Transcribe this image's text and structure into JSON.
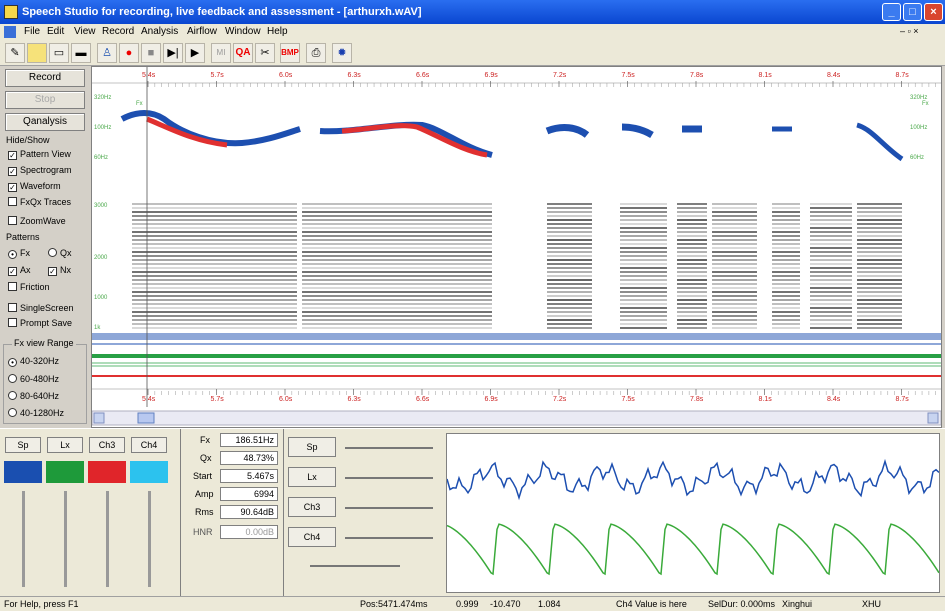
{
  "window": {
    "title": "Speech Studio for recording, live feedback and assessment - [arthurxh.wAV]"
  },
  "menu": [
    "File",
    "Edit",
    "View",
    "Record",
    "Analysis",
    "Airflow",
    "Window",
    "Help"
  ],
  "toolbar": {
    "qa": "QA",
    "bmp": "BMP"
  },
  "left": {
    "record": "Record",
    "stop": "Stop",
    "qanalysis": "Qanalysis",
    "hideshow": "Hide/Show",
    "pattern_view": "Pattern View",
    "spectrogram": "Spectrogram",
    "waveform": "Waveform",
    "fxqx": "FxQx Traces",
    "zoomwave": "ZoomWave",
    "patterns": "Patterns",
    "fx": "Fx",
    "qx": "Qx",
    "ax": "Ax",
    "nx": "Nx",
    "friction": "Friction",
    "singlescreen": "SingleScreen",
    "promptsave": "Prompt Save",
    "fxrange": "Fx view Range",
    "ranges": [
      "40-320Hz",
      "60-480Hz",
      "80-640Hz",
      "40-1280Hz"
    ]
  },
  "timeline": {
    "ticks": [
      "5.4s",
      "5.7s",
      "6.0s",
      "6.3s",
      "6.6s",
      "6.9s",
      "7.2s",
      "7.5s",
      "7.8s",
      "8.1s",
      "8.4s",
      "8.7s"
    ]
  },
  "axis": {
    "fx_hi": "320Hz",
    "fx_mid": "100Hz",
    "fx_lo": "60Hz",
    "fx_label": "Fx",
    "spec": [
      "3000",
      "2000",
      "1000",
      "1k"
    ]
  },
  "channels": {
    "labels": [
      "Sp",
      "Lx",
      "Ch3",
      "Ch4"
    ],
    "colors": [
      "#1a4fb0",
      "#1e9a3a",
      "#e0252a",
      "#2cc2ee"
    ]
  },
  "measures": {
    "fx_label": "Fx",
    "fx": "186.51Hz",
    "qx_label": "Qx",
    "qx": "48.73%",
    "start_label": "Start",
    "start": "5.467s",
    "amp_label": "Amp",
    "amp": "6994",
    "rms_label": "Rms",
    "rms": "90.64dB",
    "hnr_label": "HNR",
    "hnr": "0.00dB"
  },
  "sliders": [
    "Sp",
    "Lx",
    "Ch3",
    "Ch4"
  ],
  "status": {
    "help": "For Help, press F1",
    "pos": "Pos:5471.474ms",
    "v1": "0.999",
    "v2": "-10.470",
    "v3": "1.084",
    "ch4": "Ch4 Value is here",
    "seldur": "SelDur: 0.000ms",
    "user": "Xinghui",
    "mode": "XHU"
  }
}
